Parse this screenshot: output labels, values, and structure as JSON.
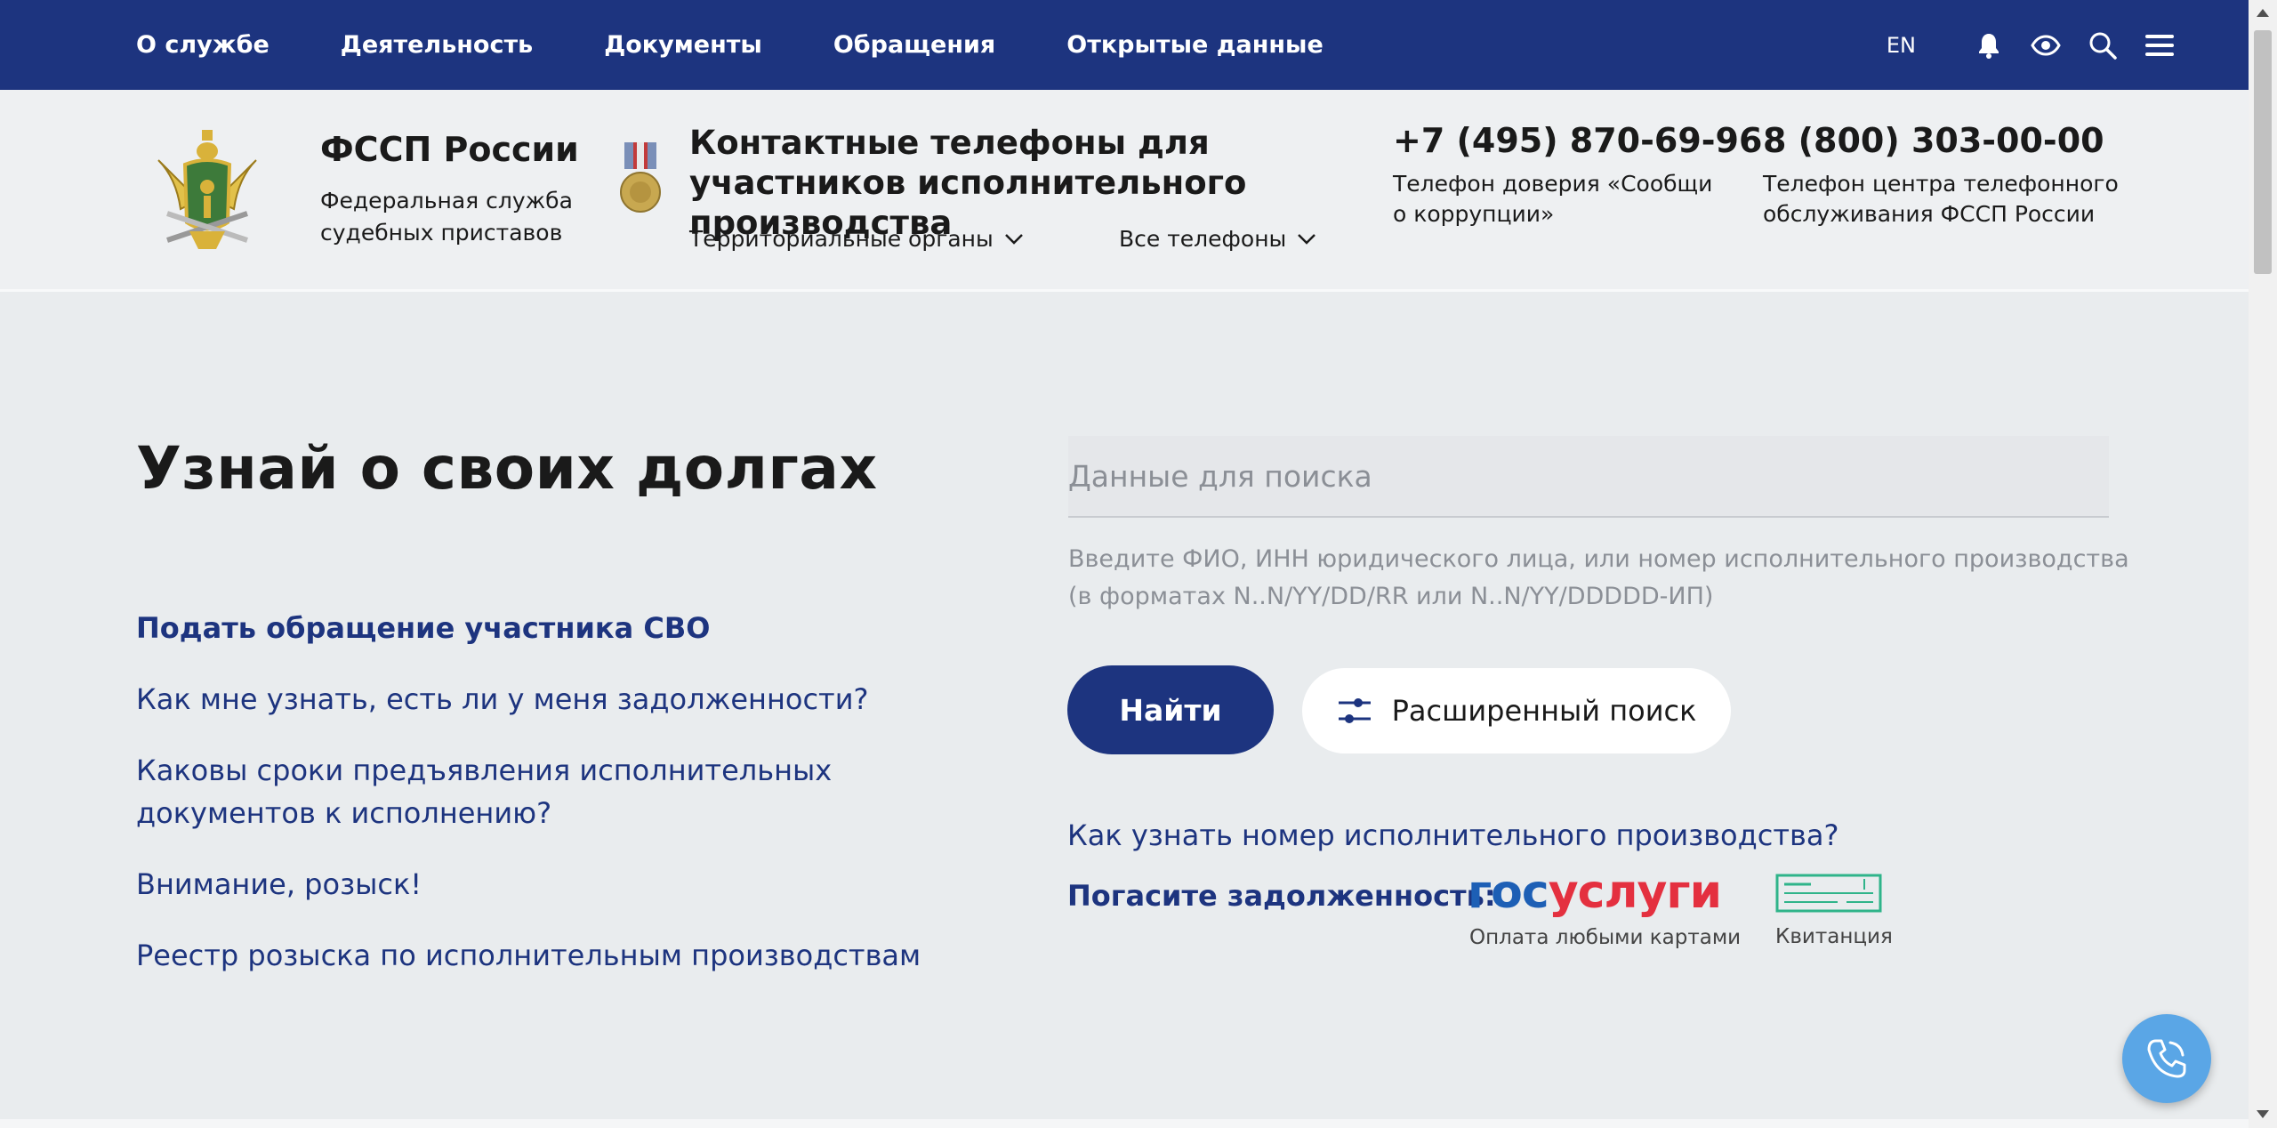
{
  "topnav": {
    "items": [
      "О службе",
      "Деятельность",
      "Документы",
      "Обращения",
      "Открытые данные"
    ],
    "lang": "EN"
  },
  "header": {
    "brand_title": "ФССП России",
    "brand_subtitle": "Федеральная служба судебных приставов",
    "contacts_title": "Контактные телефоны для участников исполнительного производства",
    "dropdown_regions": "Территориальные органы",
    "dropdown_phones": "Все телефоны",
    "phone1": "+7 (495) 870-69-96",
    "phone1_desc": "Телефон доверия «Сообщи о коррупции»",
    "phone2": "8 (800) 303-00-00",
    "phone2_desc": "Телефон центра телефонного обслуживания ФССП России"
  },
  "main": {
    "heading": "Узнай о своих долгах",
    "links": [
      "Подать обращение участника СВО",
      "Как мне узнать, есть ли у меня задолженности?",
      "Каковы сроки предъявления исполнительных документов к исполнению?",
      "Внимание, розыск!",
      "Реестр розыска по исполнительным производствам"
    ],
    "search_placeholder": "Данные для поиска",
    "search_hint": "Введите ФИО, ИНН юридического лица, или номер исполнительного производства (в форматах N..N/YY/DD/RR или N..N/YY/DDDDD-ИП)",
    "find_button": "Найти",
    "advanced_button": "Расширенный поиск",
    "how_link": "Как узнать номер исполнительного производства?",
    "pay_label": "Погасите задолженность:",
    "gosuslugi_part1": "гос",
    "gosuslugi_part2": "услуги",
    "gosuslugi_caption": "Оплата любыми картами",
    "receipt_caption": "Квитанция"
  },
  "colors": {
    "brand_blue": "#1d347f",
    "page_bg": "#e9ecee",
    "gos_blue": "#1d5fb5",
    "gos_red": "#e4303f",
    "receipt_green": "#2fb48a",
    "fab_blue": "#5aa6e6"
  },
  "icons": [
    "bell-icon",
    "eye-icon",
    "search-icon",
    "menu-icon",
    "chevron-down-icon",
    "sliders-icon",
    "phone-icon",
    "receipt-icon",
    "emblem-icon",
    "medal-icon"
  ]
}
